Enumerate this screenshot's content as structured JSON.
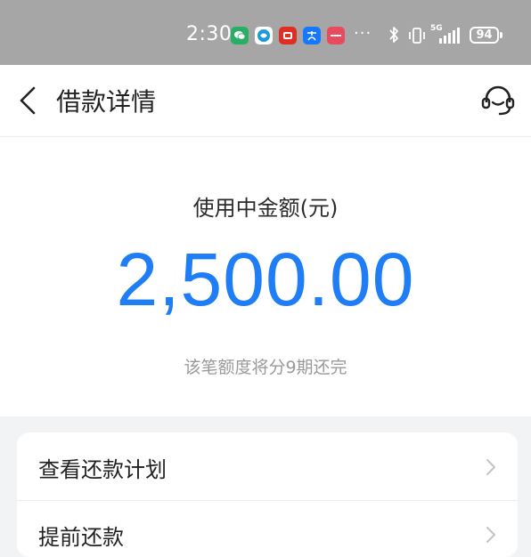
{
  "status_bar": {
    "time": "2:30",
    "more_indicator": "···",
    "network": "5G",
    "battery": "94",
    "app_icons": [
      {
        "name": "wechat-icon",
        "color": "#2aae67"
      },
      {
        "name": "browser-icon",
        "color": "#1a9ad6"
      },
      {
        "name": "pinduoduo-icon",
        "color": "#e02e24"
      },
      {
        "name": "alipay-icon",
        "color": "#1677ff"
      },
      {
        "name": "huawei-icon",
        "color": "#e84a5f"
      }
    ]
  },
  "header": {
    "title": "借款详情",
    "back_icon": "back-arrow-icon",
    "service_icon": "customer-service-icon"
  },
  "amount": {
    "label": "使用中金额(元)",
    "value": "2,500.00",
    "note": "该笔额度将分9期还完",
    "accent_color": "#1f7df6"
  },
  "menu": {
    "items": [
      {
        "label": "查看还款计划"
      },
      {
        "label": "提前还款"
      }
    ]
  }
}
